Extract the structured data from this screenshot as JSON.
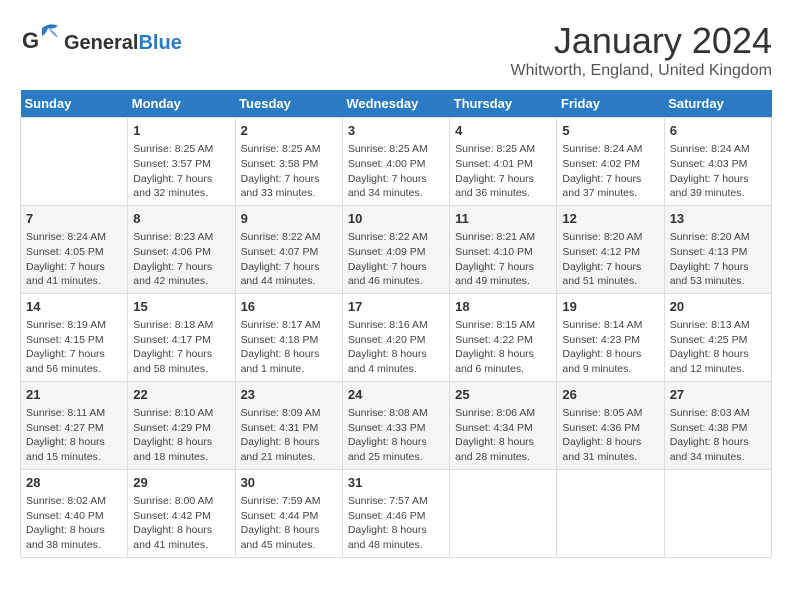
{
  "header": {
    "logo_general": "General",
    "logo_blue": "Blue",
    "month_title": "January 2024",
    "location": "Whitworth, England, United Kingdom"
  },
  "calendar": {
    "weekdays": [
      "Sunday",
      "Monday",
      "Tuesday",
      "Wednesday",
      "Thursday",
      "Friday",
      "Saturday"
    ],
    "weeks": [
      [
        {
          "day": "",
          "info": ""
        },
        {
          "day": "1",
          "info": "Sunrise: 8:25 AM\nSunset: 3:57 PM\nDaylight: 7 hours\nand 32 minutes."
        },
        {
          "day": "2",
          "info": "Sunrise: 8:25 AM\nSunset: 3:58 PM\nDaylight: 7 hours\nand 33 minutes."
        },
        {
          "day": "3",
          "info": "Sunrise: 8:25 AM\nSunset: 4:00 PM\nDaylight: 7 hours\nand 34 minutes."
        },
        {
          "day": "4",
          "info": "Sunrise: 8:25 AM\nSunset: 4:01 PM\nDaylight: 7 hours\nand 36 minutes."
        },
        {
          "day": "5",
          "info": "Sunrise: 8:24 AM\nSunset: 4:02 PM\nDaylight: 7 hours\nand 37 minutes."
        },
        {
          "day": "6",
          "info": "Sunrise: 8:24 AM\nSunset: 4:03 PM\nDaylight: 7 hours\nand 39 minutes."
        }
      ],
      [
        {
          "day": "7",
          "info": "Sunrise: 8:24 AM\nSunset: 4:05 PM\nDaylight: 7 hours\nand 41 minutes."
        },
        {
          "day": "8",
          "info": "Sunrise: 8:23 AM\nSunset: 4:06 PM\nDaylight: 7 hours\nand 42 minutes."
        },
        {
          "day": "9",
          "info": "Sunrise: 8:22 AM\nSunset: 4:07 PM\nDaylight: 7 hours\nand 44 minutes."
        },
        {
          "day": "10",
          "info": "Sunrise: 8:22 AM\nSunset: 4:09 PM\nDaylight: 7 hours\nand 46 minutes."
        },
        {
          "day": "11",
          "info": "Sunrise: 8:21 AM\nSunset: 4:10 PM\nDaylight: 7 hours\nand 49 minutes."
        },
        {
          "day": "12",
          "info": "Sunrise: 8:20 AM\nSunset: 4:12 PM\nDaylight: 7 hours\nand 51 minutes."
        },
        {
          "day": "13",
          "info": "Sunrise: 8:20 AM\nSunset: 4:13 PM\nDaylight: 7 hours\nand 53 minutes."
        }
      ],
      [
        {
          "day": "14",
          "info": "Sunrise: 8:19 AM\nSunset: 4:15 PM\nDaylight: 7 hours\nand 56 minutes."
        },
        {
          "day": "15",
          "info": "Sunrise: 8:18 AM\nSunset: 4:17 PM\nDaylight: 7 hours\nand 58 minutes."
        },
        {
          "day": "16",
          "info": "Sunrise: 8:17 AM\nSunset: 4:18 PM\nDaylight: 8 hours\nand 1 minute."
        },
        {
          "day": "17",
          "info": "Sunrise: 8:16 AM\nSunset: 4:20 PM\nDaylight: 8 hours\nand 4 minutes."
        },
        {
          "day": "18",
          "info": "Sunrise: 8:15 AM\nSunset: 4:22 PM\nDaylight: 8 hours\nand 6 minutes."
        },
        {
          "day": "19",
          "info": "Sunrise: 8:14 AM\nSunset: 4:23 PM\nDaylight: 8 hours\nand 9 minutes."
        },
        {
          "day": "20",
          "info": "Sunrise: 8:13 AM\nSunset: 4:25 PM\nDaylight: 8 hours\nand 12 minutes."
        }
      ],
      [
        {
          "day": "21",
          "info": "Sunrise: 8:11 AM\nSunset: 4:27 PM\nDaylight: 8 hours\nand 15 minutes."
        },
        {
          "day": "22",
          "info": "Sunrise: 8:10 AM\nSunset: 4:29 PM\nDaylight: 8 hours\nand 18 minutes."
        },
        {
          "day": "23",
          "info": "Sunrise: 8:09 AM\nSunset: 4:31 PM\nDaylight: 8 hours\nand 21 minutes."
        },
        {
          "day": "24",
          "info": "Sunrise: 8:08 AM\nSunset: 4:33 PM\nDaylight: 8 hours\nand 25 minutes."
        },
        {
          "day": "25",
          "info": "Sunrise: 8:06 AM\nSunset: 4:34 PM\nDaylight: 8 hours\nand 28 minutes."
        },
        {
          "day": "26",
          "info": "Sunrise: 8:05 AM\nSunset: 4:36 PM\nDaylight: 8 hours\nand 31 minutes."
        },
        {
          "day": "27",
          "info": "Sunrise: 8:03 AM\nSunset: 4:38 PM\nDaylight: 8 hours\nand 34 minutes."
        }
      ],
      [
        {
          "day": "28",
          "info": "Sunrise: 8:02 AM\nSunset: 4:40 PM\nDaylight: 8 hours\nand 38 minutes."
        },
        {
          "day": "29",
          "info": "Sunrise: 8:00 AM\nSunset: 4:42 PM\nDaylight: 8 hours\nand 41 minutes."
        },
        {
          "day": "30",
          "info": "Sunrise: 7:59 AM\nSunset: 4:44 PM\nDaylight: 8 hours\nand 45 minutes."
        },
        {
          "day": "31",
          "info": "Sunrise: 7:57 AM\nSunset: 4:46 PM\nDaylight: 8 hours\nand 48 minutes."
        },
        {
          "day": "",
          "info": ""
        },
        {
          "day": "",
          "info": ""
        },
        {
          "day": "",
          "info": ""
        }
      ]
    ]
  }
}
